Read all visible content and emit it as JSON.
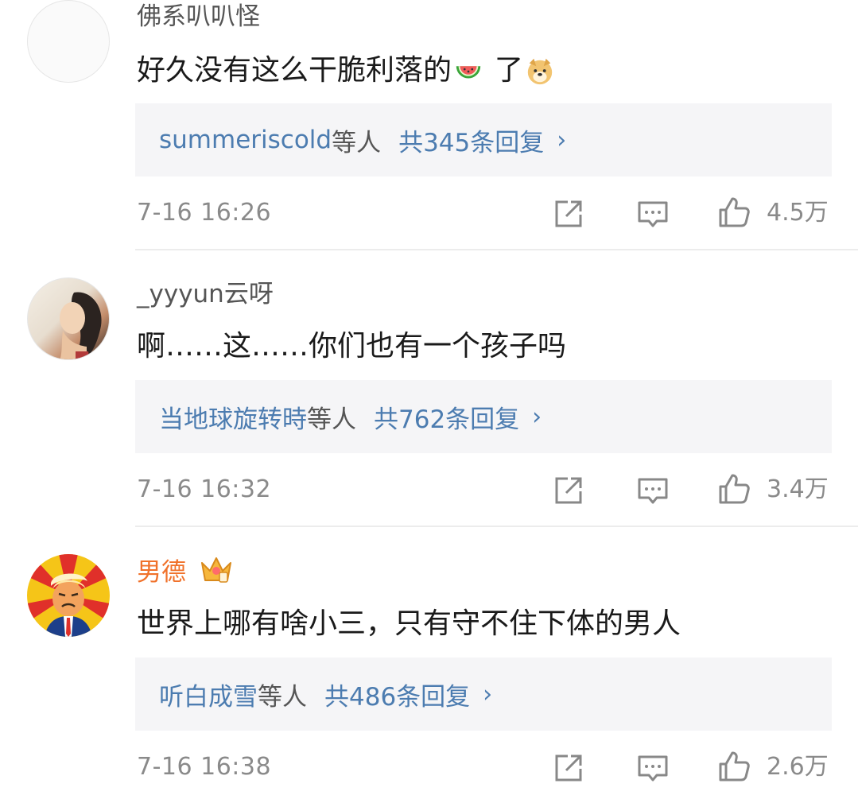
{
  "comments": [
    {
      "username": "佛系叭叭怪",
      "text": "好久没有这么干脆利落的",
      "text_suffix": "了",
      "emojis": [
        "watermelon-emoji",
        "doge-emoji"
      ],
      "reply_users": "summeriscold",
      "reply_etc": "等人",
      "reply_count": "共345条回复",
      "reply_chevron": "›",
      "time": "7-16 16:26",
      "likes": "4.5万"
    },
    {
      "username": "_yyyun云呀",
      "text": "啊……这……你们也有一个孩子吗",
      "reply_users": "当地球旋转時",
      "reply_etc": "等人",
      "reply_count": "共762条回复",
      "reply_chevron": "›",
      "time": "7-16 16:32",
      "likes": "3.4万"
    },
    {
      "username": "男德",
      "username_color": "#f0712a",
      "badge": "crown-vip-icon",
      "text": "世界上哪有啥小三，只有守不住下体的男人",
      "reply_users": "听白成雪",
      "reply_etc": "等人",
      "reply_count": "共486条回复",
      "reply_chevron": "›",
      "time": "7-16 16:38",
      "likes": "2.6万"
    }
  ],
  "icons": {
    "share": "share-icon",
    "comment": "comment-icon",
    "like": "thumbs-up-icon"
  },
  "colors": {
    "link_blue": "#4c7cb0",
    "reply_bg": "#f5f5f7",
    "meta_gray": "#8a8a8a",
    "vip_orange": "#f0712a"
  }
}
